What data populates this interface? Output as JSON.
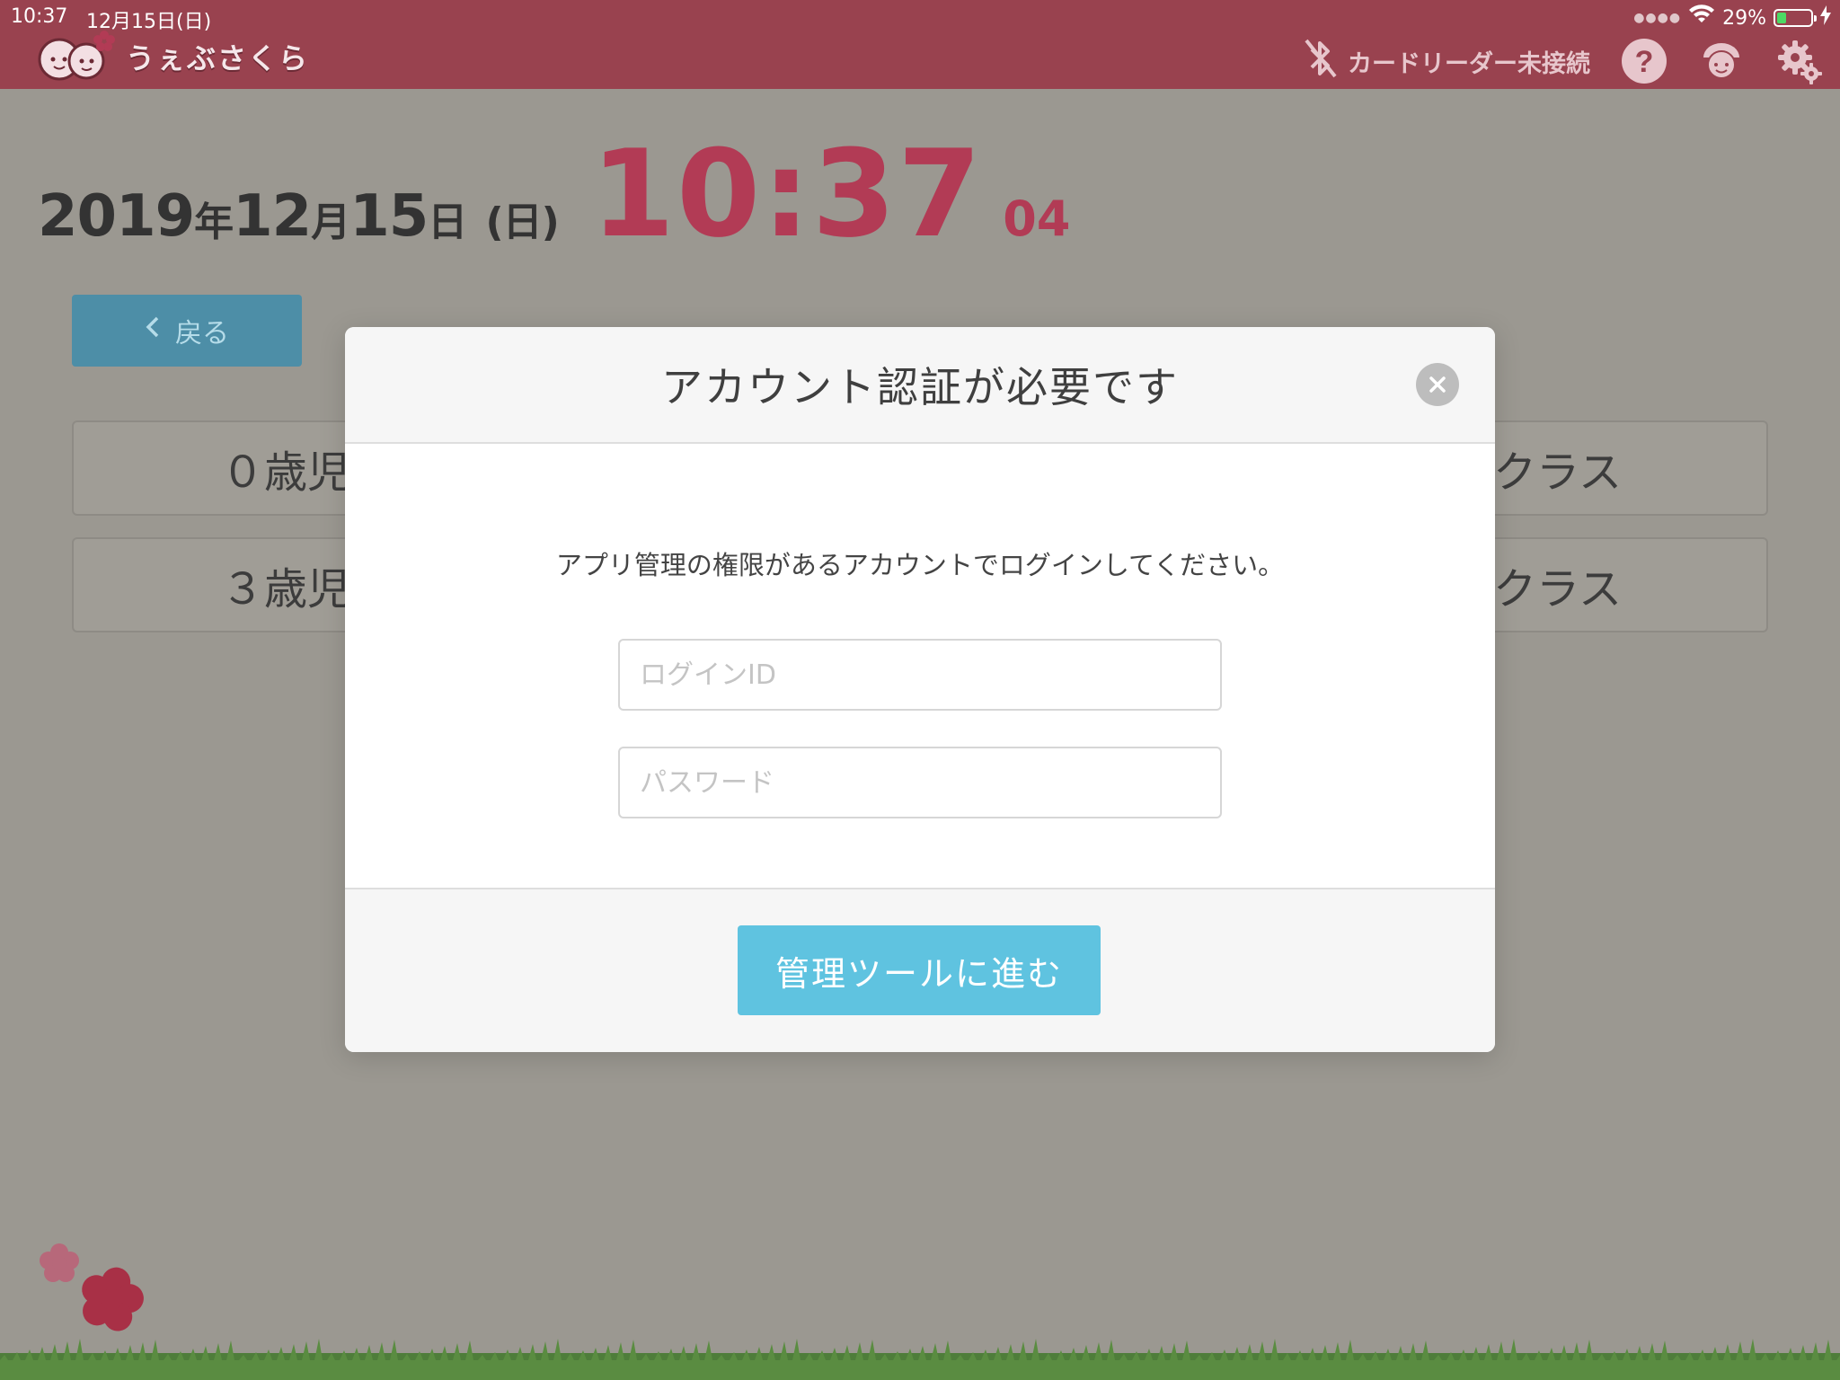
{
  "status_bar": {
    "time": "10:37",
    "date": "12月15日(日)",
    "battery": "29%",
    "battery_level": 0.29
  },
  "header": {
    "app_name": "うぇぶさくら",
    "reader_status": "カードリーダー未接続",
    "icons": [
      "bluetooth-off-icon",
      "help-icon",
      "teacher-icon",
      "settings-icon"
    ]
  },
  "datetime": {
    "year": "2019",
    "year_suffix": "年",
    "month": "12",
    "month_suffix": "月",
    "day": "15",
    "day_suffix": "日",
    "weekday": "(日)",
    "clock": "10:37",
    "seconds": "04"
  },
  "back_button": {
    "label": "戻る"
  },
  "classes": {
    "left": [
      "０歳児",
      "３歳児"
    ],
    "right": [
      "クラス",
      "クラス"
    ]
  },
  "modal": {
    "title": "アカウント認証が必要です",
    "message": "アプリ管理の権限があるアカウントでログインしてください。",
    "login_id": {
      "placeholder": "ログインID",
      "value": ""
    },
    "password": {
      "placeholder": "パスワード",
      "value": ""
    },
    "submit_label": "管理ツールに進む"
  },
  "colors": {
    "header": "#99424f",
    "accent": "#b23b55",
    "primary_button": "#5fc3e0",
    "overlay_background": "#9b9891"
  }
}
